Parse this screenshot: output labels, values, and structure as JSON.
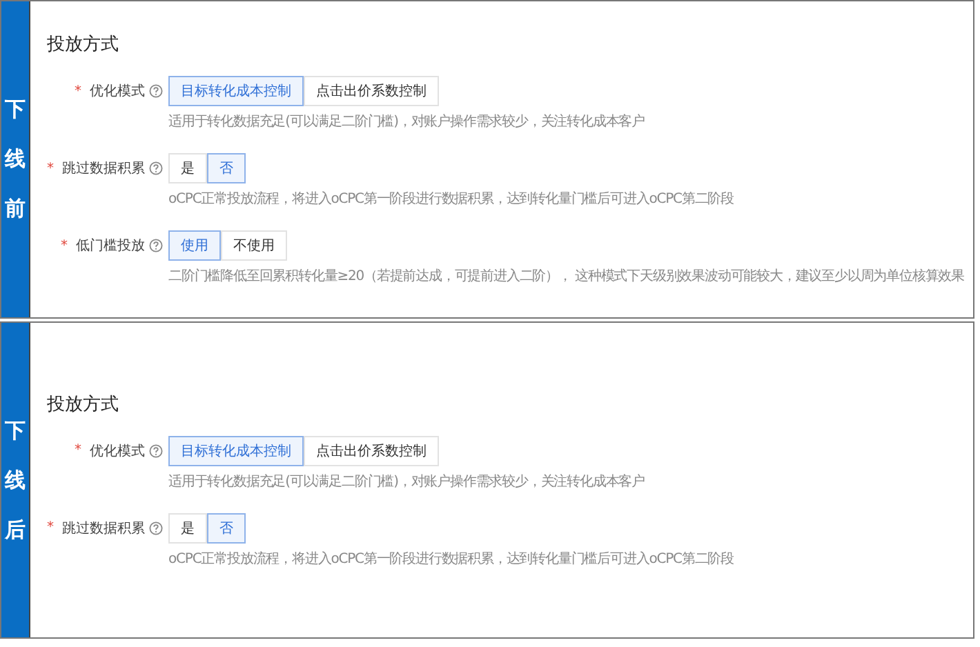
{
  "panels": [
    {
      "side_label": "下线前",
      "title": "投放方式",
      "fields": [
        {
          "required_mark": "*",
          "label": "优化模式",
          "options": [
            {
              "label": "目标转化成本控制",
              "selected": true
            },
            {
              "label": "点击出价系数控制",
              "selected": false
            }
          ],
          "description": "适用于转化数据充足(可以满足二阶门槛)，对账户操作需求较少，关注转化成本客户"
        },
        {
          "required_mark": "*",
          "label": "跳过数据积累",
          "options": [
            {
              "label": "是",
              "selected": false
            },
            {
              "label": "否",
              "selected": true
            }
          ],
          "description": "oCPC正常投放流程，将进入oCPC第一阶段进行数据积累，达到转化量门槛后可进入oCPC第二阶段"
        },
        {
          "required_mark": "*",
          "label": "低门槛投放",
          "options": [
            {
              "label": "使用",
              "selected": true
            },
            {
              "label": "不使用",
              "selected": false
            }
          ],
          "description": "二阶门槛降低至回累积转化量≥20（若提前达成，可提前进入二阶）， 这种模式下天级别效果波动可能较大，建议至少以周为单位核算效果"
        }
      ]
    },
    {
      "side_label": "下线后",
      "title": "投放方式",
      "fields": [
        {
          "required_mark": "*",
          "label": "优化模式",
          "options": [
            {
              "label": "目标转化成本控制",
              "selected": true
            },
            {
              "label": "点击出价系数控制",
              "selected": false
            }
          ],
          "description": "适用于转化数据充足(可以满足二阶门槛)，对账户操作需求较少，关注转化成本客户"
        },
        {
          "required_mark": "*",
          "label": "跳过数据积累",
          "options": [
            {
              "label": "是",
              "selected": false
            },
            {
              "label": "否",
              "selected": true
            }
          ],
          "description": "oCPC正常投放流程，将进入oCPC第一阶段进行数据积累，达到转化量门槛后可进入oCPC第二阶段"
        }
      ]
    }
  ]
}
